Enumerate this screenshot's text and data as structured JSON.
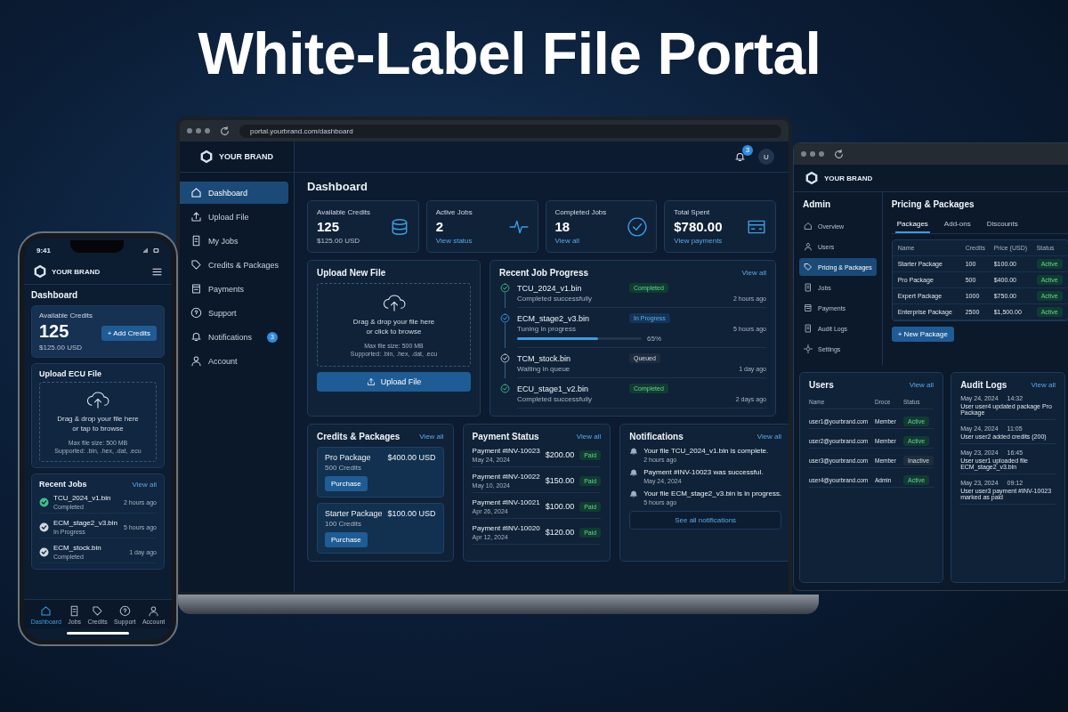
{
  "headline": "White-Label File Portal",
  "laptop": {
    "url": "portal.yourbrand.com/dashboard",
    "brand": "YOUR BRAND",
    "notification_count": "3",
    "avatar": "U",
    "sidebar": [
      {
        "label": "Dashboard",
        "selected": true
      },
      {
        "label": "Upload File",
        "selected": false
      },
      {
        "label": "My Jobs",
        "selected": false
      },
      {
        "label": "Credits & Packages",
        "selected": false
      },
      {
        "label": "Payments",
        "selected": false
      },
      {
        "label": "Support",
        "selected": false
      },
      {
        "label": "Notifications",
        "selected": false,
        "badge": "3"
      },
      {
        "label": "Account",
        "selected": false
      }
    ],
    "page_title": "Dashboard",
    "stats": [
      {
        "label": "Available Credits",
        "value": "125",
        "sub": "$125.00 USD"
      },
      {
        "label": "Active Jobs",
        "value": "2",
        "link": "View status"
      },
      {
        "label": "Completed Jobs",
        "value": "18",
        "link": "View all"
      },
      {
        "label": "Total Spent",
        "value": "$780.00",
        "link": "View payments"
      }
    ],
    "upload": {
      "title": "Upload New File",
      "line1": "Drag & drop your file here",
      "line2": "or click to browse",
      "max": "Max file size: 500 MB",
      "supported": "Supported: .bin, .hex, .dat, .ecu",
      "button": "Upload File"
    },
    "job_progress": {
      "title": "Recent Job Progress",
      "link": "View all",
      "jobs": [
        {
          "name": "TCU_2024_v1.bin",
          "detail": "Completed successfully",
          "status": "Completed",
          "kind": "completed",
          "time": "2 hours ago"
        },
        {
          "name": "ECM_stage2_v3.bin",
          "detail": "Tuning in progress",
          "status": "In Progress",
          "kind": "in_progress",
          "time": "5 hours ago",
          "level": 0.65,
          "percent": "65%"
        },
        {
          "name": "TCM_stock.bin",
          "detail": "Waiting in queue",
          "status": "Queued",
          "kind": "queued",
          "time": "1 day ago"
        },
        {
          "name": "ECU_stage1_v2.bin",
          "detail": "Completed successfully",
          "status": "Completed",
          "kind": "completed",
          "time": "2 days ago"
        }
      ]
    },
    "credits": {
      "title": "Credits & Packages",
      "link": "View all",
      "packages": [
        {
          "name": "Pro Package",
          "credits": "500 Credits",
          "price": "$400.00 USD",
          "button": "Purchase"
        },
        {
          "name": "Starter Package",
          "credits": "100 Credits",
          "price": "$100.00 USD",
          "button": "Purchase"
        }
      ]
    },
    "payments": {
      "title": "Payment Status",
      "link": "View all",
      "rows": [
        {
          "name": "Payment #INV-10023",
          "date": "May 24, 2024",
          "amount": "$200.00",
          "status": "Paid"
        },
        {
          "name": "Payment #INV-10022",
          "date": "May 10, 2024",
          "amount": "$150.00",
          "status": "Paid"
        },
        {
          "name": "Payment #INV-10021",
          "date": "Apr 26, 2024",
          "amount": "$100.00",
          "status": "Paid"
        },
        {
          "name": "Payment #INV-10020",
          "date": "Apr 12, 2024",
          "amount": "$120.00",
          "status": "Paid"
        }
      ]
    },
    "notifications": {
      "title": "Notifications",
      "link": "View all",
      "items": [
        {
          "text": "Your file TCU_2024_v1.bin is complete.",
          "time": "2 hours ago"
        },
        {
          "text": "Payment #INV-10023 was successful.",
          "time": "May 24, 2024"
        },
        {
          "text": "Your file ECM_stage2_v3.bin is in progress.",
          "time": "5 hours ago"
        }
      ],
      "button": "See all notifications"
    }
  },
  "phone": {
    "time": "9:41",
    "brand": "YOUR BRAND",
    "page_title": "Dashboard",
    "credits": {
      "label": "Available Credits",
      "value": "125",
      "sub": "$125.00 USD",
      "button": "+ Add Credits"
    },
    "upload": {
      "title": "Upload ECU File",
      "line1": "Drag & drop your file here",
      "line2": "or tap to browse",
      "max": "Max file size: 500 MB",
      "supported": "Supported: .bin, .hex, .dat, .ecu"
    },
    "jobs": {
      "title": "Recent Jobs",
      "link": "View all",
      "items": [
        {
          "name": "TCU_2024_v1.bin",
          "status": "Completed",
          "time": "2 hours ago",
          "color": "#3fbf8a"
        },
        {
          "name": "ECM_stage2_v3.bin",
          "status": "In Progress",
          "time": "5 hours ago",
          "color": "#d0d8e0"
        },
        {
          "name": "ECM_stock.bin",
          "status": "Completed",
          "time": "1 day ago",
          "color": "#d0d8e0"
        }
      ]
    },
    "nav": [
      {
        "label": "Dashboard",
        "selected": true
      },
      {
        "label": "Jobs",
        "selected": false
      },
      {
        "label": "Credits",
        "selected": false
      },
      {
        "label": "Support",
        "selected": false
      },
      {
        "label": "Account",
        "selected": false
      }
    ]
  },
  "admin": {
    "brand": "YOUR BRAND",
    "section": "Admin",
    "sidebar": [
      {
        "label": "Overview",
        "selected": false
      },
      {
        "label": "Users",
        "selected": false
      },
      {
        "label": "Pricing & Packages",
        "selected": true
      },
      {
        "label": "Jobs",
        "selected": false
      },
      {
        "label": "Payments",
        "selected": false
      },
      {
        "label": "Audit Logs",
        "selected": false
      },
      {
        "label": "Settings",
        "selected": false
      }
    ],
    "title": "Pricing & Packages",
    "tabs": [
      {
        "label": "Packages",
        "selected": true
      },
      {
        "label": "Add-ons",
        "selected": false
      },
      {
        "label": "Discounts",
        "selected": false
      }
    ],
    "columns": [
      "Name",
      "Credits",
      "Price (USD)",
      "Status"
    ],
    "rows": [
      {
        "name": "Starter Package",
        "credits": "100",
        "price": "$100.00",
        "status": "Active"
      },
      {
        "name": "Pro Package",
        "credits": "500",
        "price": "$400.00",
        "status": "Active"
      },
      {
        "name": "Expert Package",
        "credits": "1000",
        "price": "$750.00",
        "status": "Active"
      },
      {
        "name": "Enterprise Package",
        "credits": "2500",
        "price": "$1,500.00",
        "status": "Active"
      }
    ],
    "button": "+ New Package",
    "users": {
      "title": "Users",
      "link": "View all",
      "columns": [
        "Name",
        "Droce",
        "Status"
      ],
      "rows": [
        {
          "email": "user1@yourbrand.com",
          "role": "Member",
          "status": "Active",
          "active": true
        },
        {
          "email": "user2@yourbrand.com",
          "role": "Member",
          "status": "Active",
          "active": true
        },
        {
          "email": "user3@yourbrand.com",
          "role": "Member",
          "status": "Inactive",
          "active": false
        },
        {
          "email": "user4@yourbrand.com",
          "role": "Admin",
          "status": "Active",
          "active": true
        }
      ]
    },
    "audit": {
      "title": "Audit Logs",
      "link": "View all",
      "entries": [
        {
          "date": "May 24, 2024",
          "time": "14:32",
          "text": "User user4 updated package Pro Package"
        },
        {
          "date": "May 24, 2024",
          "time": "11:05",
          "text": "User user2 added credits (200)"
        },
        {
          "date": "May 23, 2024",
          "time": "16:45",
          "text": "User user1 uploaded file ECM_stage2_v3.bin"
        },
        {
          "date": "May 23, 2024",
          "time": "09:12",
          "text": "User user3 payment #INV-10023 marked as paid"
        }
      ]
    }
  }
}
